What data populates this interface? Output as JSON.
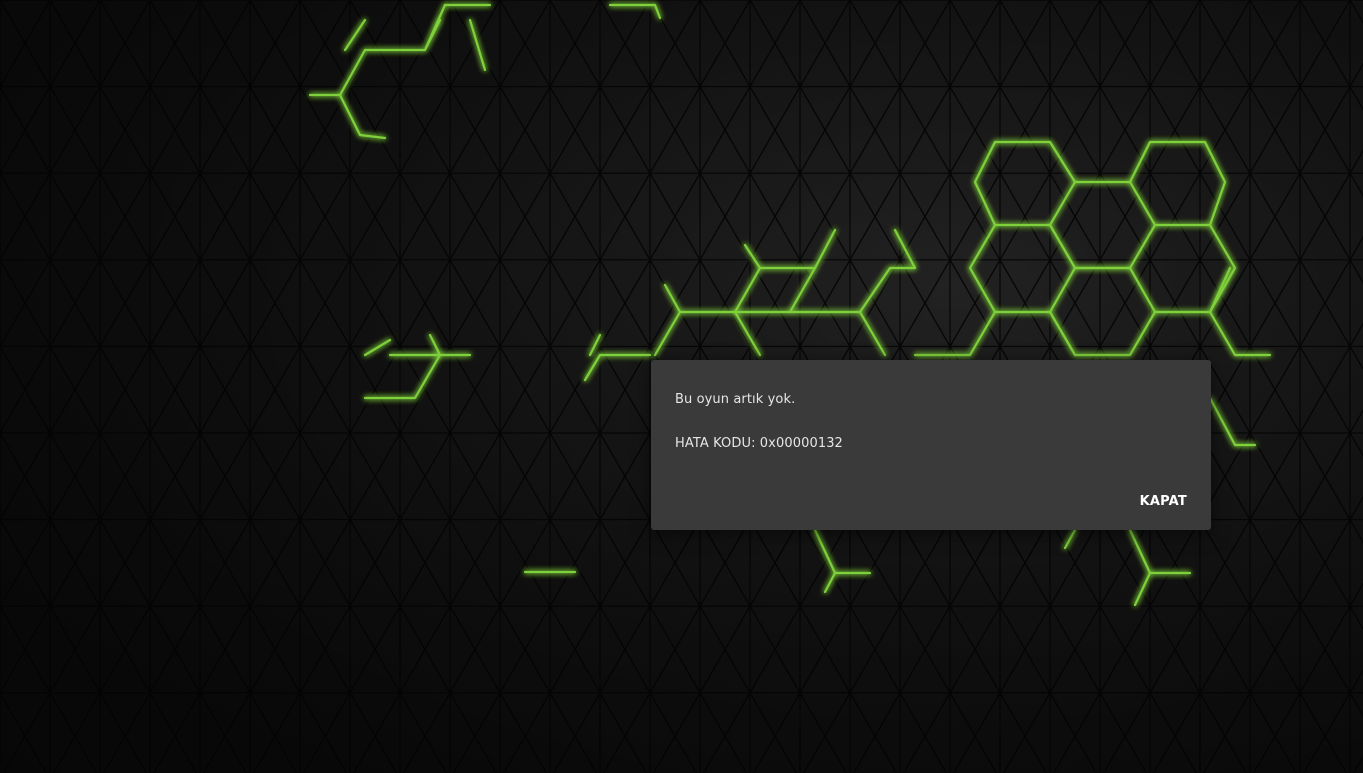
{
  "theme": {
    "background": "#141414",
    "accent": "#76b900",
    "dialog_bg": "#3a3a3a",
    "text": "#e6e6e6",
    "button_text": "#ffffff"
  },
  "dialog": {
    "message": "Bu oyun artık yok.",
    "error_code": "HATA KODU: 0x00000132",
    "close_label": "KAPAT"
  }
}
